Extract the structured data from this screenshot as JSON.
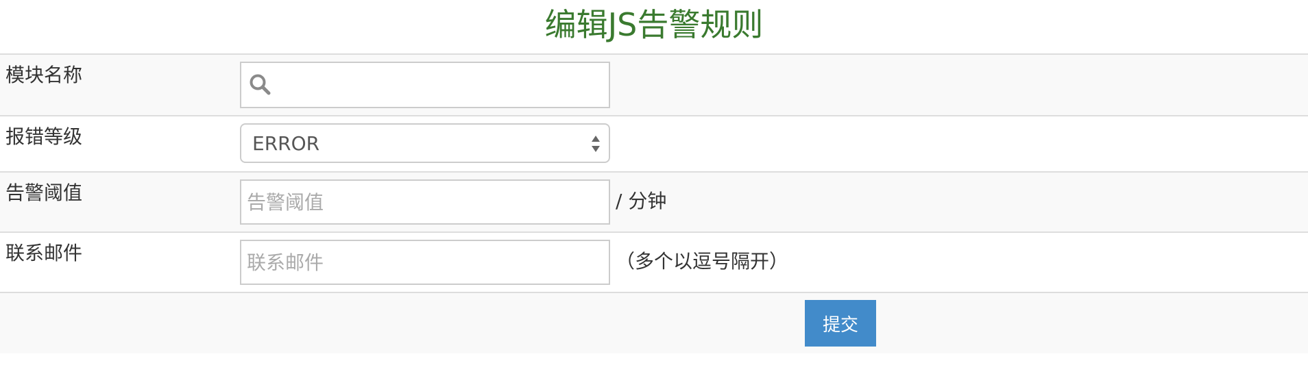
{
  "page": {
    "title": "编辑JS告警规则"
  },
  "form": {
    "module": {
      "label": "模块名称",
      "value": "",
      "icon": "search-icon"
    },
    "level": {
      "label": "报错等级",
      "selected": "ERROR"
    },
    "threshold": {
      "label": "告警阈值",
      "placeholder": "告警阈值",
      "suffix": "/ 分钟"
    },
    "email": {
      "label": "联系邮件",
      "placeholder": "联系邮件",
      "hint": "（多个以逗号隔开）"
    },
    "submit_label": "提交"
  },
  "colors": {
    "title": "#3a7a2f",
    "submit": "#428bca",
    "stripe": "#f9f9f9",
    "border": "#dddddd"
  }
}
